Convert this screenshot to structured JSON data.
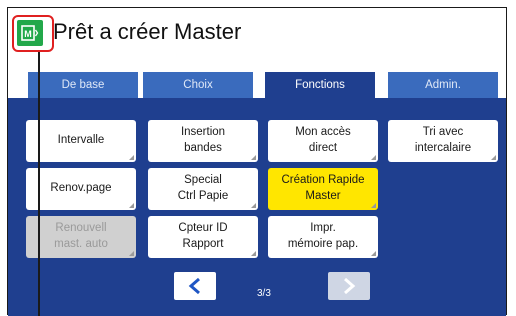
{
  "header": {
    "title": "Prêt a créer Master",
    "status_icon": "master-making-mode-icon",
    "accent_color": "#22a84a",
    "callout_color": "#e02020"
  },
  "tabs": [
    {
      "label": "De base",
      "active": false
    },
    {
      "label": "Choix",
      "active": false
    },
    {
      "label": "Fonctions",
      "active": true
    },
    {
      "label": "Admin.",
      "active": false
    }
  ],
  "functions": [
    {
      "label": "Intervalle",
      "state": "normal"
    },
    {
      "label": "Insertion\nbandes",
      "state": "normal"
    },
    {
      "label": "Mon accès\ndirect",
      "state": "normal"
    },
    {
      "label": "Tri avec\nintercalaire",
      "state": "normal"
    },
    {
      "label": "Renov.page",
      "state": "normal"
    },
    {
      "label": "Special\nCtrl Papie",
      "state": "normal"
    },
    {
      "label": "Création Rapide\nMaster",
      "state": "selected"
    },
    {
      "label": "Renouvell\nmast. auto",
      "state": "disabled"
    },
    {
      "label": "Cpteur ID\nRapport",
      "state": "normal"
    },
    {
      "label": "Impr.\nmémoire pap.",
      "state": "normal"
    }
  ],
  "pagination": {
    "indicator": "3/3",
    "prev_icon": "chevron-left-icon",
    "next_icon": "chevron-right-icon",
    "next_enabled": false
  },
  "colors": {
    "panel": "#1f3f8f",
    "tab": "#3a6bbd",
    "selected": "#ffe600",
    "disabled": "#d0d0d0"
  }
}
